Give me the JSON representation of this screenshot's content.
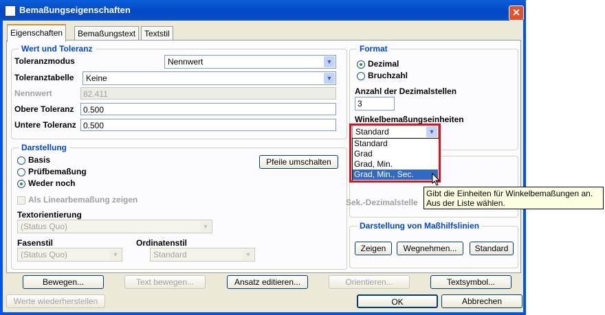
{
  "window": {
    "title": "Bemaßungseigenschaften",
    "close_symbol": "✕"
  },
  "tabs": [
    "Eigenschaften",
    "Bemaßungstext",
    "Textstil"
  ],
  "value_tolerance": {
    "title": "Wert und Toleranz",
    "tolerance_mode_label": "Toleranzmodus",
    "tolerance_mode_value": "Nennwert",
    "tolerance_table_label": "Toleranztabelle",
    "tolerance_table_value": "Keine",
    "nominal_label": "Nennwert",
    "nominal_value": "82.411",
    "upper_label": "Obere Toleranz",
    "upper_value": "0.500",
    "lower_label": "Untere Toleranz",
    "lower_value": "0.500"
  },
  "display": {
    "title": "Darstellung",
    "options": [
      "Basis",
      "Prüfbemaßung",
      "Weder noch"
    ],
    "selected_option": "Weder noch",
    "flip_arrows_button": "Pfeile umschalten",
    "linear_checkbox": "Als Linearbemaßung zeigen",
    "text_orientation_label": "Textorientierung",
    "text_orientation_value": "(Status Quo)",
    "chamfer_label": "Fasenstil",
    "chamfer_value": "(Status Quo)",
    "ordinate_label": "Ordinatenstil",
    "ordinate_value": "Standard"
  },
  "format": {
    "title": "Format",
    "options": [
      "Dezimal",
      "Bruchzahl"
    ],
    "selected_option": "Dezimal",
    "decimals_label": "Anzahl der Dezimalstellen",
    "decimals_value": "3",
    "angle_units_label": "Winkelbemaßungseinheiten",
    "angle_units_value": "Standard",
    "angle_units_options": [
      "Standard",
      "Grad",
      "Grad, Min.",
      "Grad, Min., Sec."
    ],
    "highlighted_option": "Grad, Min., Sec.",
    "secondary_decimals_label": "Sek.-Dezimalstelle"
  },
  "extension_lines": {
    "title": "Darstellung von Maßhilfslinien",
    "show_button": "Zeigen",
    "remove_button": "Wegnehmen...",
    "default_button": "Standard"
  },
  "tooltip": {
    "line1": "Gibt die Einheiten für Winkelbemaßungen an.",
    "line2": "Aus der Liste wählen."
  },
  "bottom_buttons": {
    "move": "Bewegen...",
    "move_text": "Text bewegen...",
    "edit_attachment": "Ansatz editieren...",
    "orient": "Orientieren...",
    "text_symbol": "Textsymbol...",
    "restore": "Werte wiederherstellen",
    "ok": "OK",
    "cancel": "Abbrechen"
  }
}
